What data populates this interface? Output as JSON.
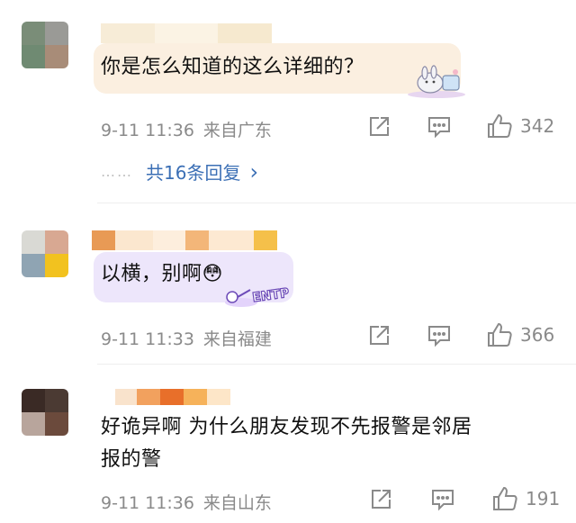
{
  "comments": [
    {
      "text": "你是怎么知道的这么详细的？",
      "time": "9-11 11:36",
      "location": "来自广东",
      "likes": "342",
      "replies_label": "共16条回复",
      "replies_dots": "……",
      "replies_chevron": "›",
      "avatar_colors": [
        "#7a8d78",
        "#9a9a96",
        "#6f8a72",
        "#a88c78"
      ],
      "name_colors": [
        "#f7ecd7",
        "#fbf3e4",
        "#f6e9cf"
      ],
      "bubble_color": "#fbefe0",
      "sticker": "rabbit-sticker"
    },
    {
      "text": "以横，别啊😳",
      "time": "9-11 11:33",
      "location": "来自福建",
      "likes": "366",
      "avatar_colors": [
        "#d9d9d4",
        "#d8a892",
        "#8fa4b3",
        "#f2c21f"
      ],
      "name_colors": [
        "#e89a55",
        "#fbe7cf",
        "#fdeedd",
        "#f3b679",
        "#fde9d2",
        "#f5c04a"
      ],
      "bubble_color": "#ede6fb",
      "sticker": "entp-sticker",
      "sticker_text": "ENTP"
    },
    {
      "text_line1": "好诡异啊 为什么朋友发现不先报警是邻居",
      "text_line2": "报的警",
      "time": "9-11 11:36",
      "location": "来自山东",
      "likes": "191",
      "avatar_colors": [
        "#3a2a25",
        "#4b3a33",
        "#b8a59c",
        "#6b4a3c"
      ],
      "name_colors": [
        "#f9e3cc",
        "#f2a15e",
        "#e86f2a",
        "#f6b25a",
        "#fde6c8"
      ]
    }
  ]
}
